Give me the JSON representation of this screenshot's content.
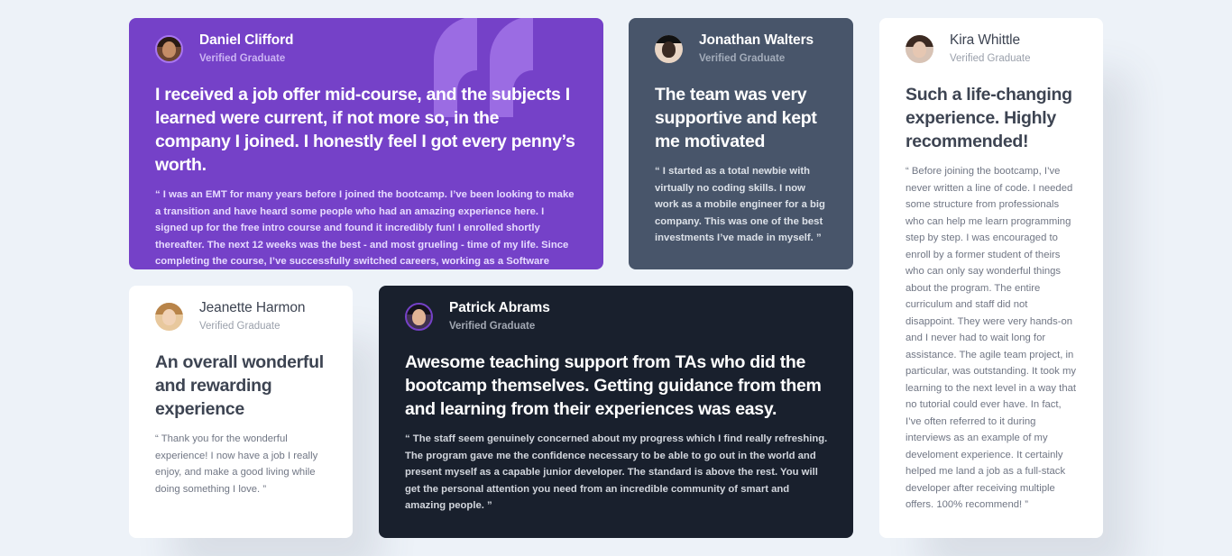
{
  "testimonials": [
    {
      "name": "Daniel Clifford",
      "role": "Verified Graduate",
      "headline": "I received a job offer mid-course, and the subjects I learned were current, if not more so, in the company I joined. I honestly feel I got every penny’s worth.",
      "body": "“ I was an EMT for many years before I joined the bootcamp. I’ve been looking to make a transition and have heard some people who had an amazing experience here. I signed up for the free intro course and found it incredibly fun! I enrolled shortly thereafter. The next 12 weeks was the best - and most grueling - time of my life. Since completing the course, I’ve successfully switched careers, working as a Software Engineer at a VR startup. ”",
      "background": "#7541c8"
    },
    {
      "name": "Jonathan Walters",
      "role": "Verified Graduate",
      "headline": "The team was very supportive and kept me motivated",
      "body": "“ I started as a total newbie with virtually no coding skills. I now work as a mobile engineer for a big company. This was one of the best investments I’ve made in myself. ”",
      "background": "#48556a"
    },
    {
      "name": "Kira Whittle",
      "role": "Verified Graduate",
      "headline": "Such a life-changing experience. Highly recommended!",
      "body": "“ Before joining the bootcamp, I’ve never written a line of code. I needed some structure from professionals who can help me learn programming step by step. I was encouraged to enroll by a former student of theirs who can only say wonderful things about the program. The entire curriculum and staff did not disappoint. They were very hands-on and I never had to wait long for assistance. The agile team project, in particular, was outstanding. It took my learning to the next level in a way that no tutorial could ever have. In fact, I’ve often referred to it during interviews as an example of my develoment experience. It certainly helped me land a job as a full-stack developer after receiving multiple offers. 100% recommend! ”",
      "background": "#ffffff"
    },
    {
      "name": "Jeanette Harmon",
      "role": "Verified Graduate",
      "headline": "An overall wonderful and rewarding experience",
      "body": "“ Thank you for the wonderful experience! I now have a job I really enjoy, and make a good living while doing something I love. ”",
      "background": "#ffffff"
    },
    {
      "name": "Patrick Abrams",
      "role": "Verified Graduate",
      "headline": "Awesome teaching support from TAs who did the bootcamp themselves. Getting guidance from them and learning from their experiences was easy.",
      "body": "“ The staff seem genuinely concerned about my progress which I find really refreshing. The program gave me the confidence necessary to be able to go out in the world and present myself as a capable junior developer. The standard is above the rest. You will get the personal attention you need from an incredible community of smart and amazing people. ”",
      "background": "#19202d"
    }
  ],
  "decor": {
    "page_background": "#edf2f8",
    "quote_icon_color": "#9b6ce3"
  }
}
